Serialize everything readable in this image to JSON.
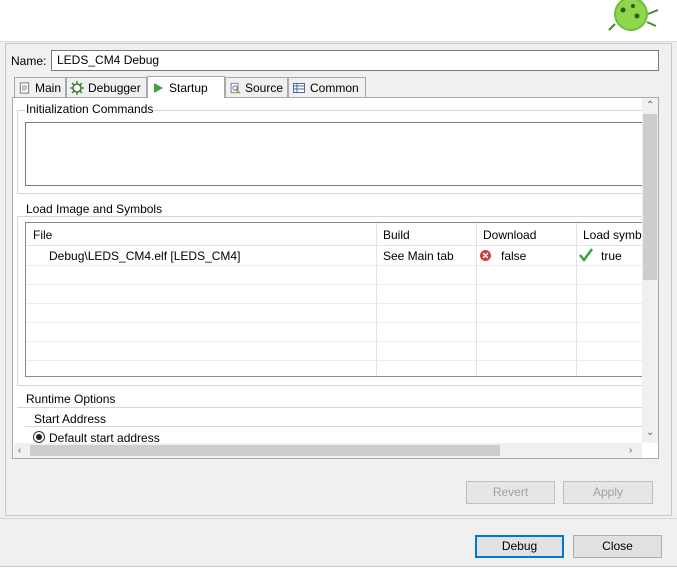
{
  "name": {
    "label": "Name:",
    "value": "LEDS_CM4 Debug"
  },
  "tabs": [
    {
      "label": "Main",
      "icon": "document-icon",
      "active": false
    },
    {
      "label": "Debugger",
      "icon": "bug-settings-icon",
      "active": false
    },
    {
      "label": "Startup",
      "icon": "play-icon",
      "active": true
    },
    {
      "label": "Source",
      "icon": "source-icon",
      "active": false
    },
    {
      "label": "Common",
      "icon": "table-icon",
      "active": false
    }
  ],
  "init": {
    "title": "Initialization Commands",
    "text": ""
  },
  "load": {
    "title": "Load Image and Symbols",
    "columns": [
      "File",
      "Build",
      "Download",
      "Load symb"
    ],
    "rows": [
      {
        "file": "Debug\\LEDS_CM4.elf [LEDS_CM4]",
        "build": "See Main tab",
        "download": "false",
        "download_icon": "error-x-icon",
        "load_symbols": "true",
        "load_icon": "green-check-icon"
      }
    ]
  },
  "runtime": {
    "title": "Runtime Options",
    "start_address_title": "Start Address",
    "default_start_label": "Default start address"
  },
  "buttons": {
    "revert": "Revert",
    "apply": "Apply",
    "debug": "Debug",
    "close": "Close"
  },
  "colors": {
    "accent": "#0078d7",
    "error": "#d83b3b",
    "check": "#3aa23a"
  }
}
